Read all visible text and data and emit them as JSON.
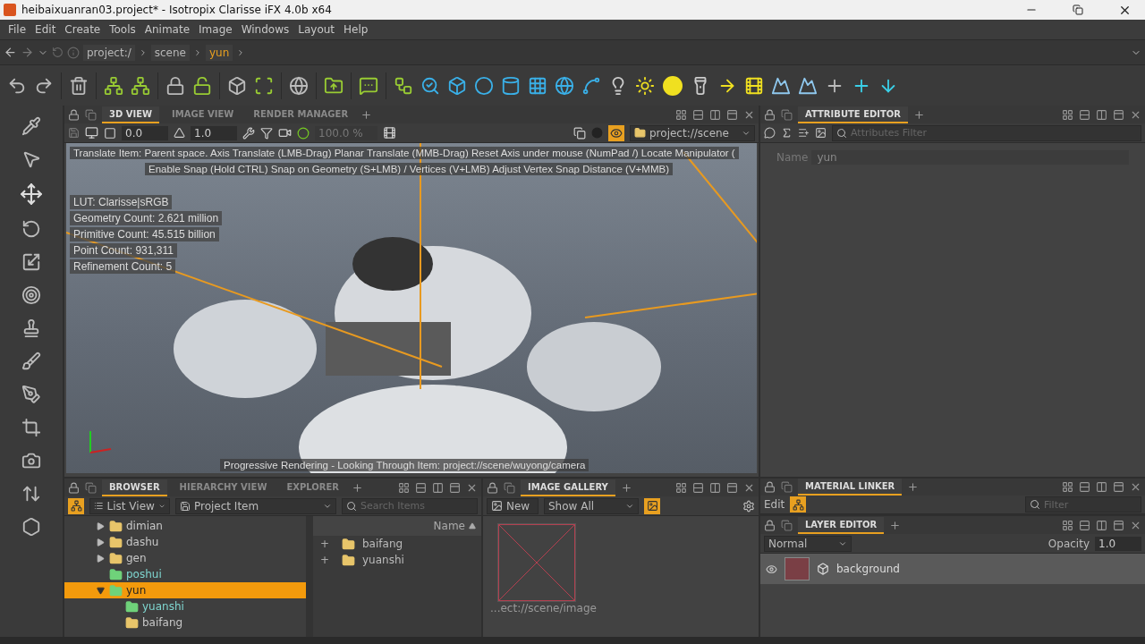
{
  "window": {
    "title": "heibaixuanran03.project* - Isotropix Clarisse iFX 4.0b x64"
  },
  "menu": [
    "File",
    "Edit",
    "Create",
    "Tools",
    "Animate",
    "Image",
    "Windows",
    "Layout",
    "Help"
  ],
  "path": [
    {
      "label": "project:/",
      "selected": false
    },
    {
      "label": "scene",
      "selected": false
    },
    {
      "label": "yun",
      "selected": true
    }
  ],
  "viewport_panel": {
    "tabs": [
      {
        "label": "3D VIEW",
        "selected": true
      },
      {
        "label": "IMAGE VIEW",
        "selected": false
      },
      {
        "label": "RENDER MANAGER",
        "selected": false
      }
    ],
    "exposure": "0.0",
    "gamma": "1.0",
    "percent": "100.0 %",
    "context": "project://scene",
    "hints": [
      "Translate Item: Parent space. Axis Translate (LMB-Drag)  Planar Translate (MMB-Drag) Reset Axis under mouse (NumPad /)  Locate Manipulator (",
      "Enable Snap (Hold CTRL) Snap on Geometry (S+LMB) / Vertices (V+LMB) Adjust Vertex Snap Distance (V+MMB)"
    ],
    "stats": [
      "LUT: Clarisse|sRGB",
      "Geometry Count: 2.621 million",
      "Primitive Count: 45.515 billion",
      "Point Count: 931,311",
      "Refinement Count: 5"
    ],
    "status": "Progressive Rendering - Looking Through Item: project://scene/wuyong/camera"
  },
  "browser": {
    "tabs": [
      {
        "label": "BROWSER",
        "selected": true
      },
      {
        "label": "HIERARCHY VIEW",
        "selected": false
      },
      {
        "label": "EXPLORER",
        "selected": false
      }
    ],
    "view_mode": "List View",
    "item_type": "Project Item",
    "search": {
      "placeholder": "Search Items"
    },
    "tree": [
      {
        "label": "dimian",
        "kind": "folder",
        "expandable": true,
        "expanded": false,
        "selected": false
      },
      {
        "label": "dashu",
        "kind": "folder",
        "expandable": true,
        "expanded": false,
        "selected": false
      },
      {
        "label": "gen",
        "kind": "folder",
        "expandable": true,
        "expanded": false,
        "selected": false
      },
      {
        "label": "poshui",
        "kind": "context",
        "expandable": false,
        "expanded": false,
        "selected": false
      },
      {
        "label": "yun",
        "kind": "context",
        "expandable": true,
        "expanded": true,
        "selected": true,
        "children": [
          {
            "label": "yuanshi",
            "kind": "context",
            "expandable": false,
            "expanded": false,
            "selected": false
          },
          {
            "label": "baifang",
            "kind": "folder",
            "expandable": false,
            "expanded": false,
            "selected": false
          }
        ]
      }
    ],
    "list_column": "Name",
    "list": [
      {
        "expander": "+",
        "label": "baifang"
      },
      {
        "expander": "+",
        "label": "yuanshi"
      }
    ]
  },
  "image_gallery": {
    "tabs": [
      {
        "label": "IMAGE GALLERY",
        "selected": true
      }
    ],
    "new_button": "New",
    "filter": "Show All",
    "caption": "...ect://scene/image"
  },
  "attribute_editor": {
    "tabs": [
      {
        "label": "ATTRIBUTE EDITOR",
        "selected": true
      }
    ],
    "filter": {
      "placeholder": "Attributes Filter"
    },
    "fields": [
      {
        "label": "Name",
        "value": "yun"
      }
    ]
  },
  "material_linker": {
    "tabs": [
      {
        "label": "MATERIAL LINKER",
        "selected": true
      }
    ],
    "edit": "Edit",
    "filter": {
      "placeholder": "Filter"
    }
  },
  "layer_editor": {
    "tabs": [
      {
        "label": "LAYER EDITOR",
        "selected": true
      }
    ],
    "blend": "Normal",
    "opacity_label": "Opacity",
    "opacity": "1.0",
    "layers": [
      {
        "name": "background"
      }
    ]
  }
}
